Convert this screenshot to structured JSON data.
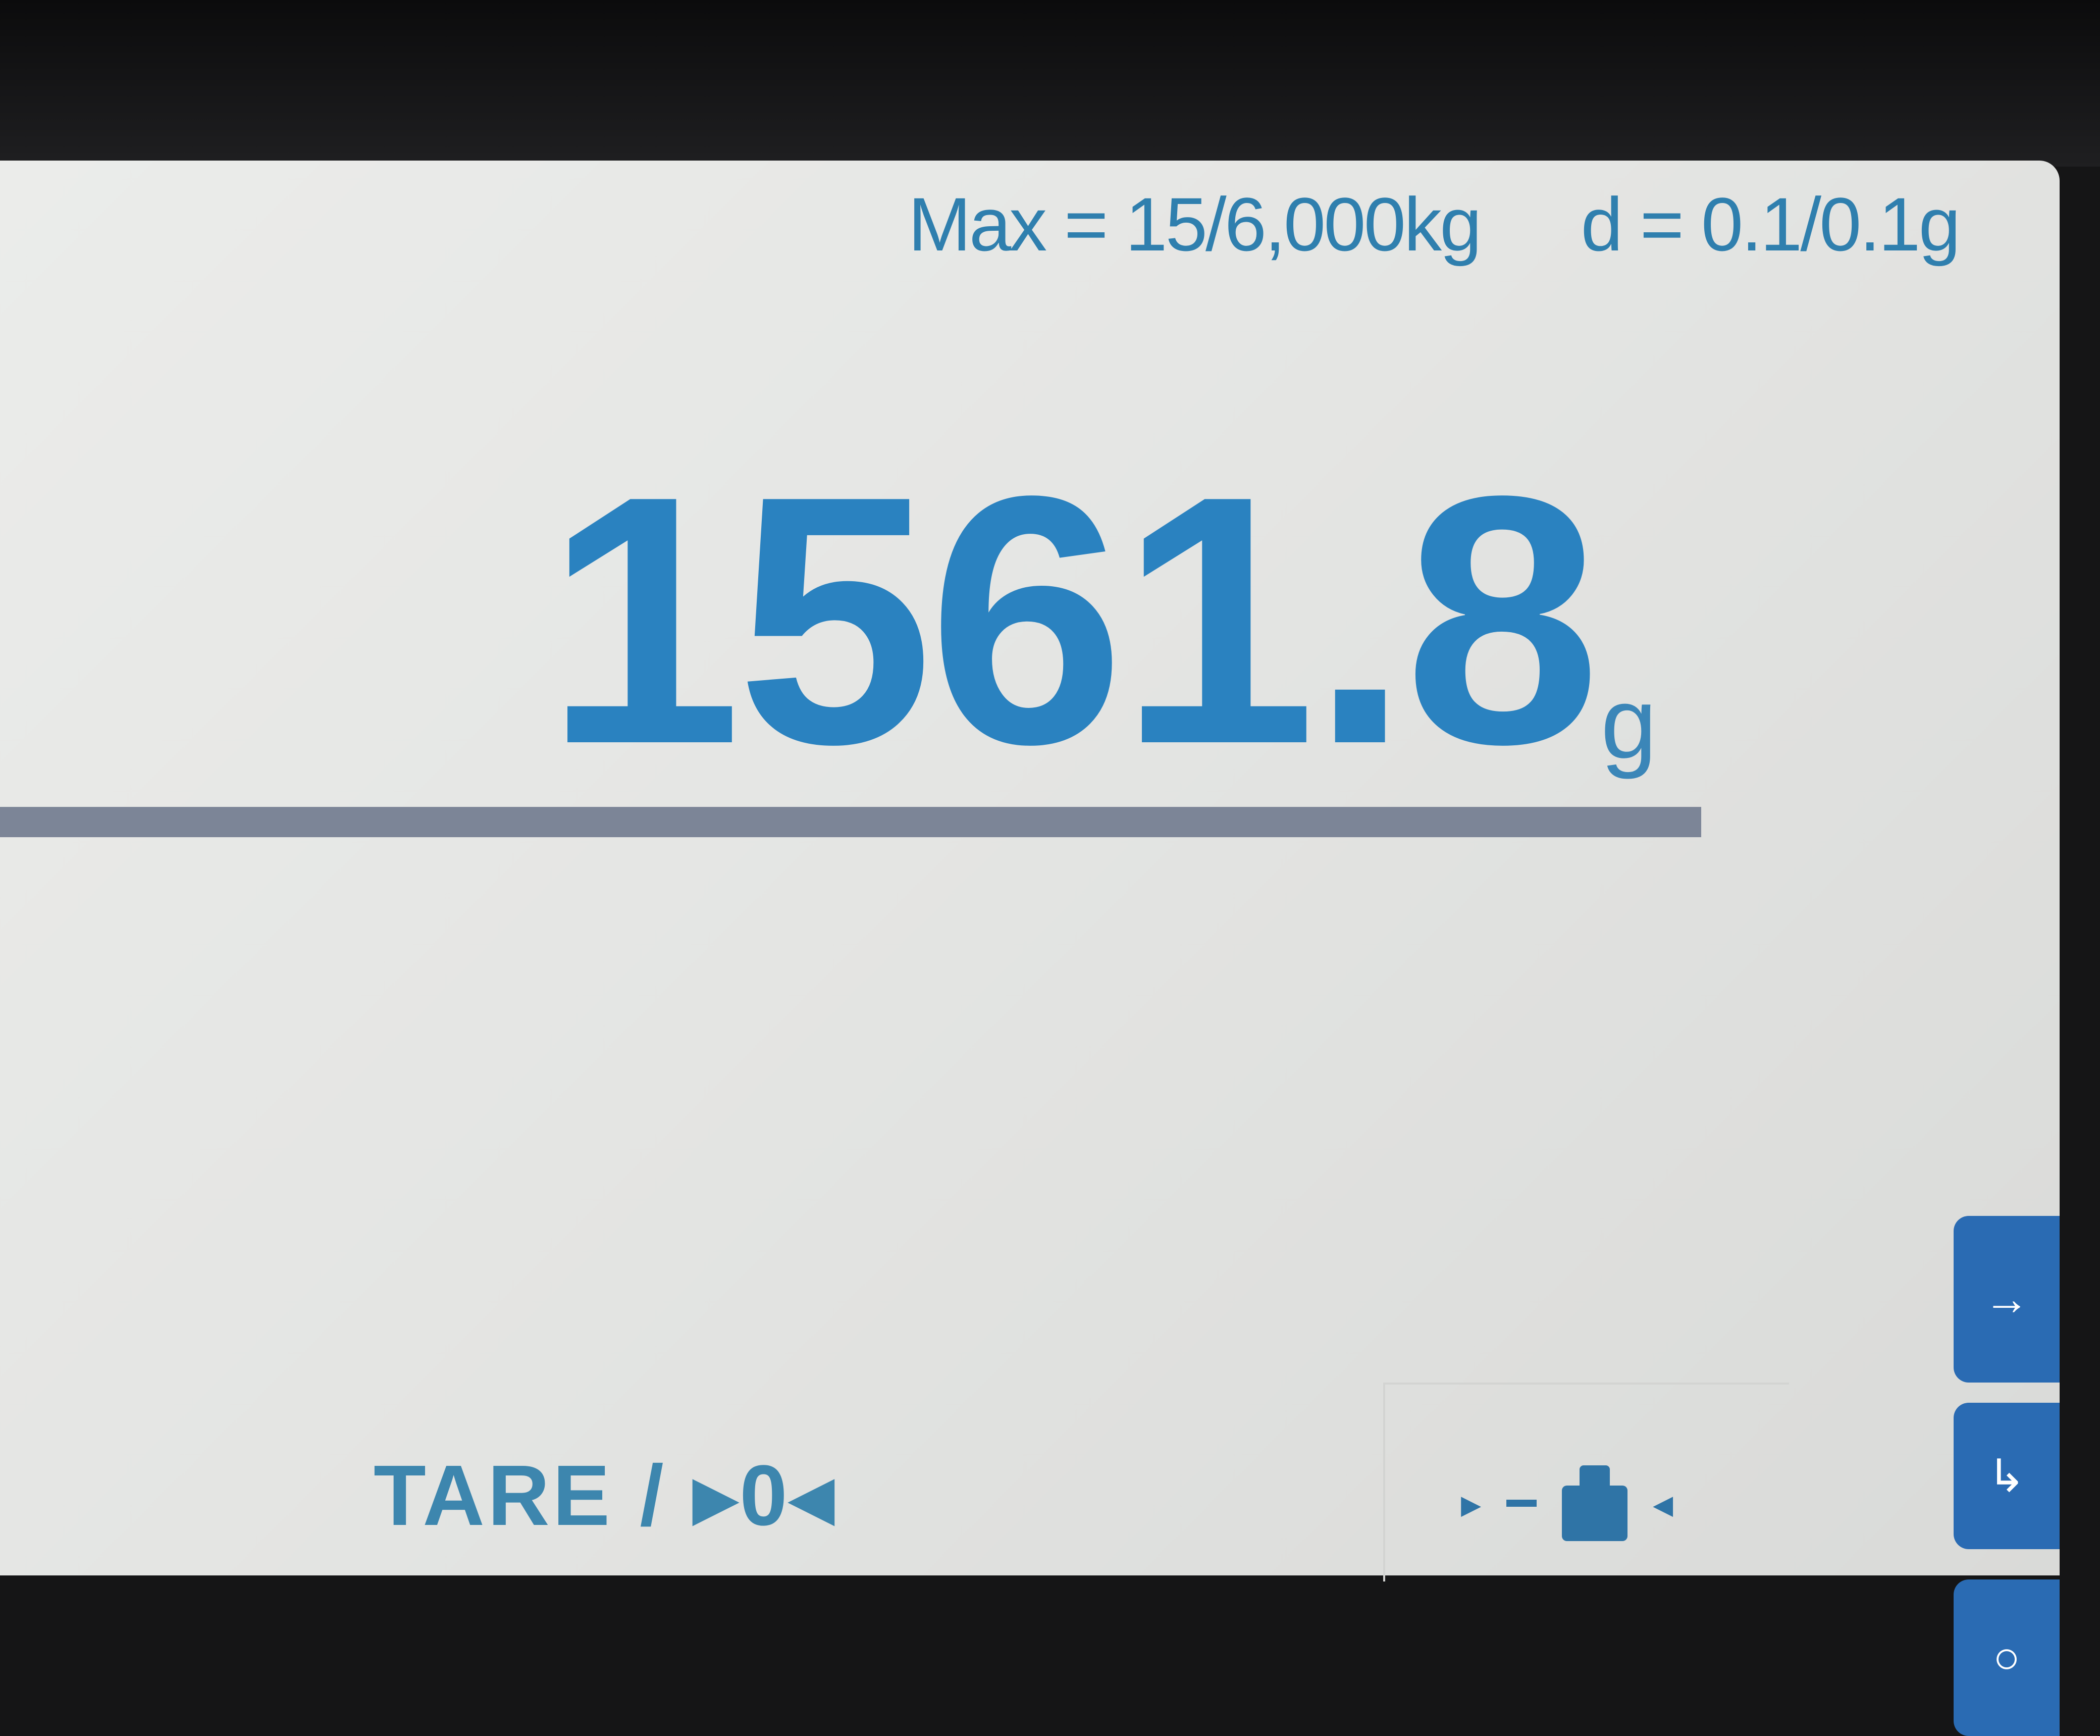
{
  "header": {
    "max_capacity": "Max = 15/6,000kg",
    "division": "d = 0.1/0.1g"
  },
  "display": {
    "weight_value": "1561.8",
    "weight_unit": "g"
  },
  "footer": {
    "tare_label": "TARE / ▸0◂"
  },
  "status_icons": {
    "left_arrow": "▸",
    "right_arrow": "◂"
  },
  "side_buttons": {
    "top_icon": "→",
    "middle_icon": "↳",
    "bottom_icon": "○"
  },
  "colors": {
    "accent": "#2a82c0",
    "bar": "#7c8597",
    "side_button": "#2a6bb3"
  }
}
